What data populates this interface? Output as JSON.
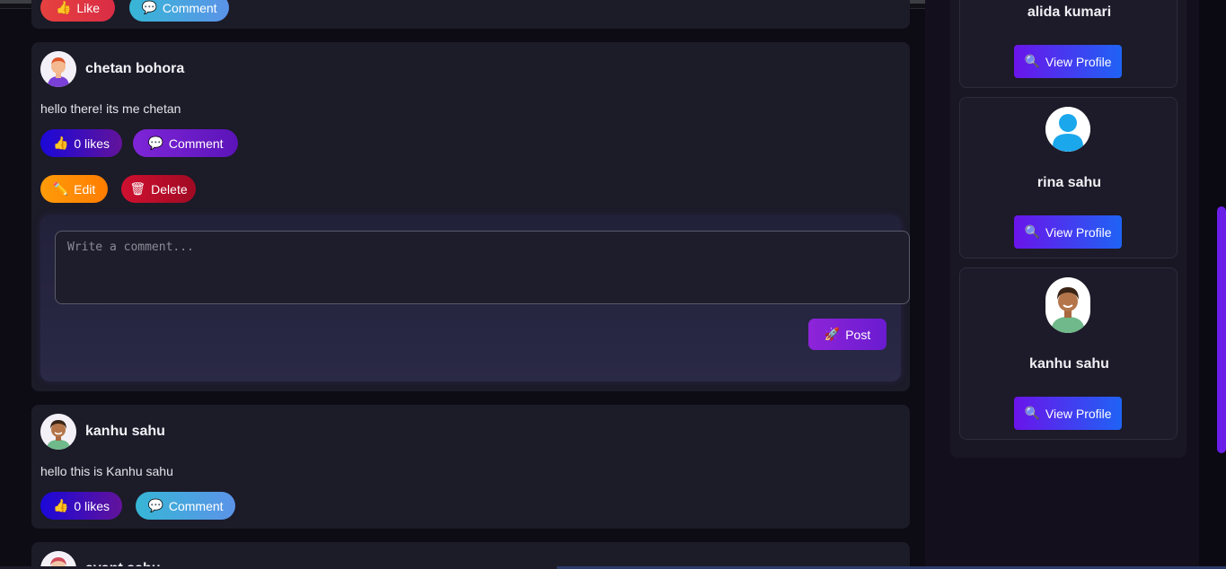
{
  "posts": [
    {
      "likes_label": "Like",
      "comment_label": "Comment"
    },
    {
      "author": "chetan bohora",
      "text": "hello there! its me chetan",
      "likes_label": "0 likes",
      "comment_label": "Comment",
      "edit_label": "Edit",
      "delete_label": "Delete",
      "comment_placeholder": "Write a comment...",
      "post_label": "Post"
    },
    {
      "author": "kanhu sahu",
      "text": "hello this is Kanhu sahu",
      "likes_label": "0 likes",
      "comment_label": "Comment"
    },
    {
      "author": "avant sahu"
    }
  ],
  "sidebar": {
    "users": [
      {
        "name": "alida kumari",
        "button_label": "View Profile"
      },
      {
        "name": "rina sahu",
        "button_label": "View Profile"
      },
      {
        "name": "kanhu sahu",
        "button_label": "View Profile"
      }
    ]
  },
  "icons": {
    "like": "thumbs-up-icon",
    "comment": "speech-bubble-icon",
    "edit": "pencil-icon",
    "delete": "trash-icon",
    "post": "rocket-icon",
    "view": "magnifier-icon"
  },
  "colors": {
    "page_bg": "#0d0b14",
    "card_bg": "#1c1b28",
    "likes_gradient_start": "#1b08d8",
    "comment_purple": "#7e25d8",
    "comment_cyan": "#37b6d6",
    "edit_orange": "#ff9b0a",
    "delete_red": "#cf1030",
    "view_button_start": "#6a14ea",
    "view_button_end": "#1f63f5"
  }
}
